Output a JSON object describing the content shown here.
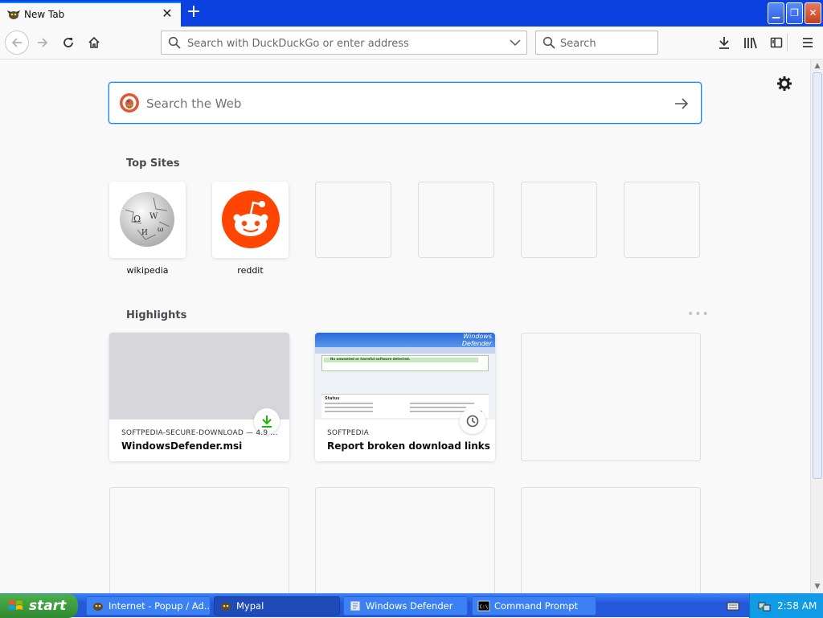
{
  "browser": {
    "tab": {
      "title": "New Tab",
      "close_glyph": "✕"
    },
    "new_tab_glyph": "+",
    "window_buttons": {
      "minimize": "▁",
      "maximize": "❐",
      "close": "✕"
    },
    "urlbar": {
      "placeholder": "Search with DuckDuckGo or enter address",
      "value": ""
    },
    "searchbar": {
      "placeholder": "Search",
      "value": ""
    }
  },
  "newtab": {
    "websearch": {
      "placeholder": "Search the Web",
      "value": ""
    },
    "top_sites": {
      "title": "Top Sites",
      "items": [
        {
          "label": "wikipedia",
          "icon": "wikipedia-icon"
        },
        {
          "label": "reddit",
          "icon": "reddit-icon"
        },
        {
          "label": ""
        },
        {
          "label": ""
        },
        {
          "label": ""
        },
        {
          "label": ""
        }
      ]
    },
    "highlights": {
      "title": "Highlights",
      "more_glyph": "•••",
      "cards": [
        {
          "source": "SOFTPEDIA-SECURE-DOWNLOAD — 4.9 ...",
          "title": "WindowsDefender.msi",
          "badge": "download-icon"
        },
        {
          "source": "SOFTPEDIA",
          "title": "Report broken download links",
          "badge": "clock-icon",
          "thumb_text": {
            "brand": "Windows",
            "brand2": "Defender",
            "notice": "No unwanted or harmful software detected.",
            "status": "Status"
          }
        }
      ]
    }
  },
  "taskbar": {
    "start_label": "start",
    "tasks": [
      {
        "label": "Internet - Popup / Ad...",
        "active": false
      },
      {
        "label": "Mypal",
        "active": true
      },
      {
        "label": "Windows Defender",
        "active": false
      },
      {
        "label": "Command Prompt",
        "active": false
      }
    ],
    "clock": "2:58 AM"
  },
  "colors": {
    "accent": "#0a84ff",
    "titlebar": "#0a41e0",
    "reddit": "#ff4500",
    "download_green": "#12bc00",
    "taskbar": "#2457d9",
    "start_green": "#3c9b3c"
  }
}
